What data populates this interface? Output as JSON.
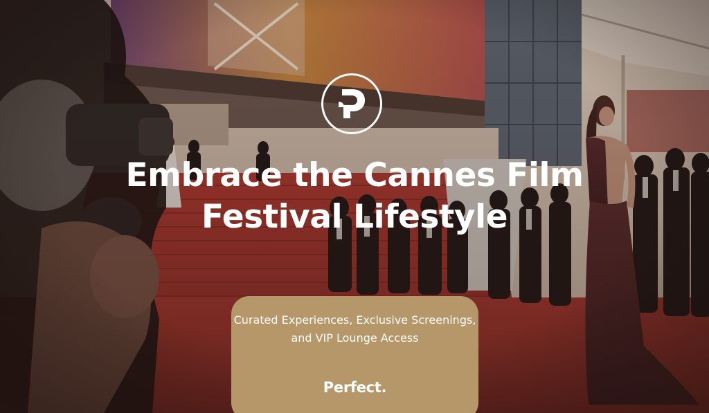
{
  "hero": {
    "headline": "Embrace the Cannes Film Festival Lifestyle",
    "photo_subject": "red carpet event with photographers and guests",
    "logo_icon": "p-monogram-icon"
  },
  "card": {
    "tagline": "Curated Experiences, Exclusive Screenings, and VIP Lounge Access",
    "brand": "Perfect."
  },
  "colors": {
    "card_background": "#b5976a",
    "text": "#ffffff",
    "carpet_red": "#b2362d",
    "overlay": "#2a1714"
  }
}
